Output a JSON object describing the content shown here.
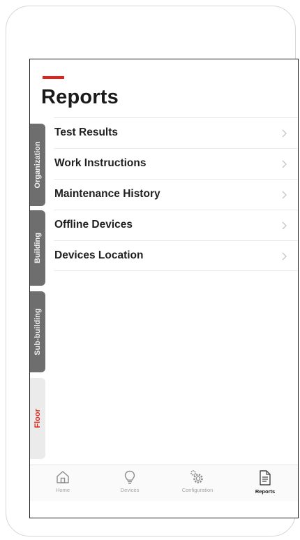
{
  "page": {
    "title": "Reports"
  },
  "menu": {
    "items": [
      {
        "label": "Test Results"
      },
      {
        "label": "Work Instructions"
      },
      {
        "label": "Maintenance History"
      },
      {
        "label": "Offline Devices"
      },
      {
        "label": "Devices Location"
      }
    ]
  },
  "side_tabs": [
    {
      "label": "Organization",
      "active": false
    },
    {
      "label": "Building",
      "active": false
    },
    {
      "label": "Sub-building",
      "active": false
    },
    {
      "label": "Floor",
      "active": true
    }
  ],
  "nav": {
    "items": [
      {
        "label": "Home",
        "icon": "home-icon"
      },
      {
        "label": "Devices",
        "icon": "lightbulb-icon"
      },
      {
        "label": "Configuration",
        "icon": "gear-icon"
      },
      {
        "label": "Reports",
        "icon": "report-document-icon",
        "active": true
      }
    ]
  },
  "colors": {
    "accent": "#e2231a",
    "tab_gray": "#6e6e6e",
    "tab_active_bg": "#ebebeb",
    "nav_inactive": "#a3a3a3"
  }
}
